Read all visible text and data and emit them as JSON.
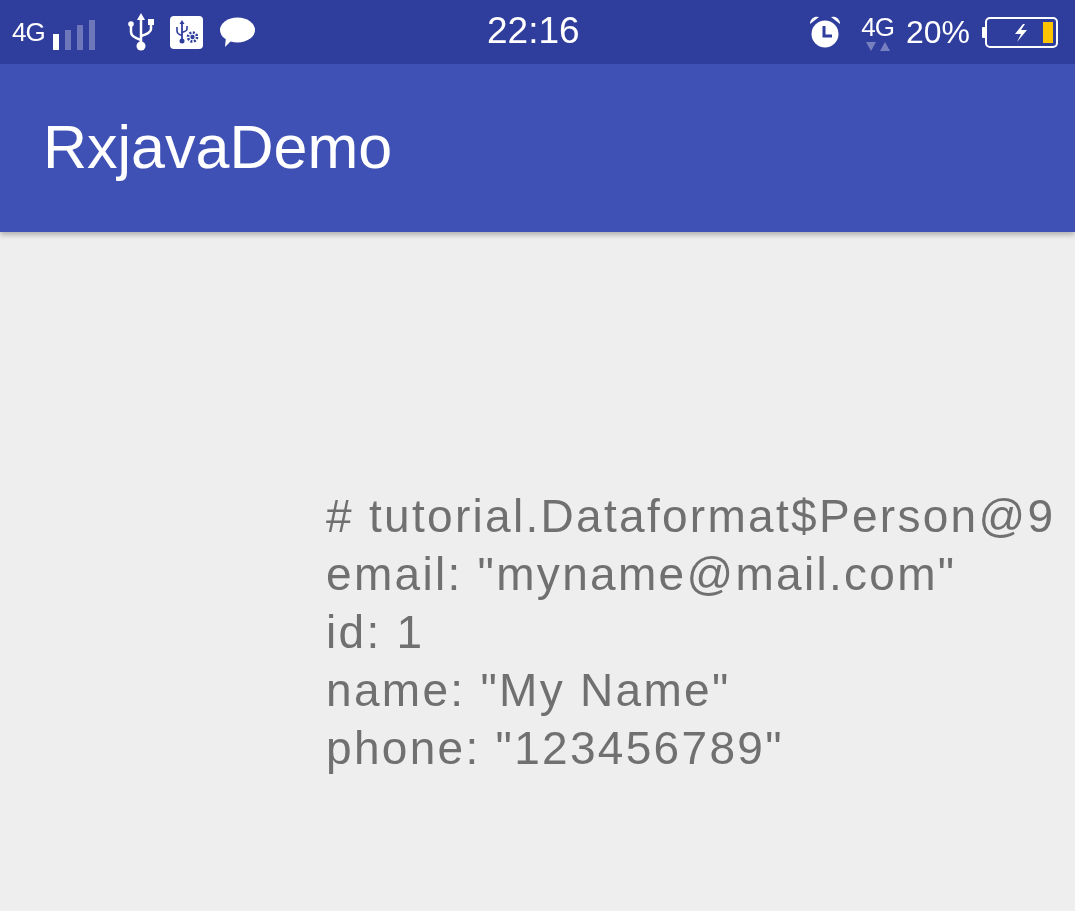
{
  "status_bar": {
    "left_network": "4G",
    "time": "22:16",
    "right_network": "4G",
    "battery": "20%"
  },
  "app_bar": {
    "title": "RxjavaDemo"
  },
  "content": {
    "lines": [
      "# tutorial.Dataformat$Person@9",
      "email: \"myname@mail.com\"",
      "id: 1",
      "name: \"My Name\"",
      "phone: \"123456789\""
    ]
  }
}
